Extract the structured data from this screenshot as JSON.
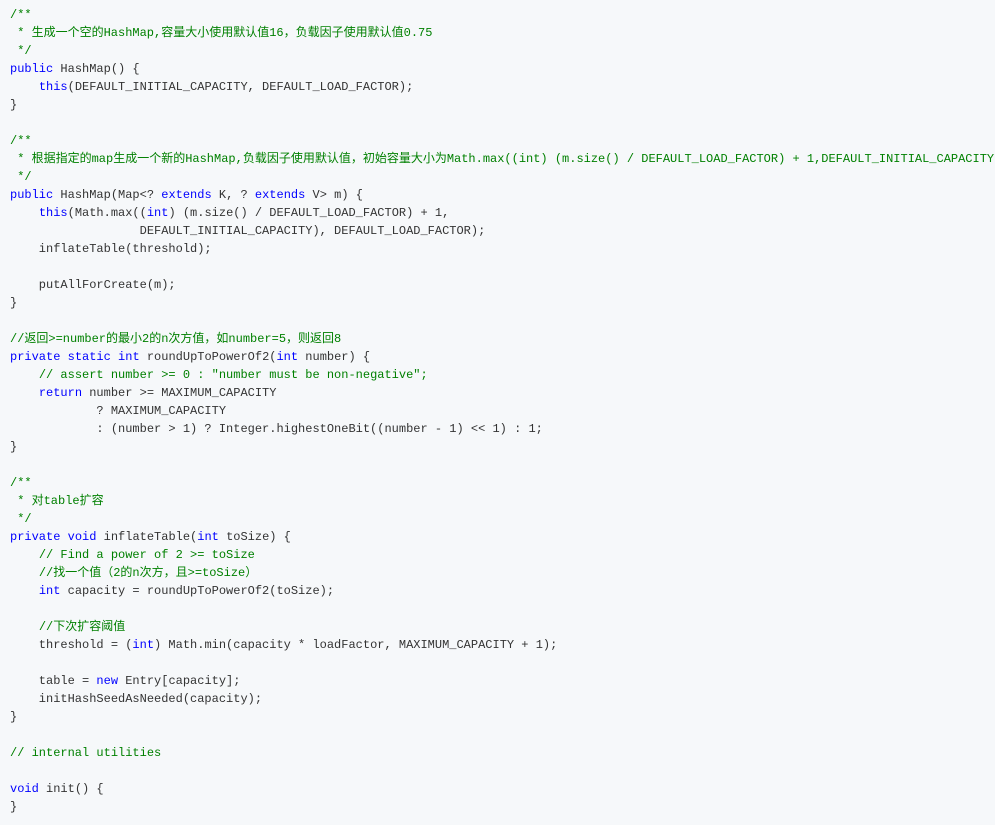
{
  "code": {
    "lines": [
      [
        [
          "comment",
          "/**"
        ]
      ],
      [
        [
          "comment",
          " * 生成一个空的HashMap,容量大小使用默认值16，负载因子使用默认值0.75"
        ]
      ],
      [
        [
          "comment",
          " */"
        ]
      ],
      [
        [
          "keyword",
          "public"
        ],
        [
          "plain",
          " HashMap() {"
        ]
      ],
      [
        [
          "plain",
          "    "
        ],
        [
          "keyword",
          "this"
        ],
        [
          "plain",
          "(DEFAULT_INITIAL_CAPACITY, DEFAULT_LOAD_FACTOR);"
        ]
      ],
      [
        [
          "plain",
          "}"
        ]
      ],
      [
        [
          "plain",
          ""
        ]
      ],
      [
        [
          "comment",
          "/**"
        ]
      ],
      [
        [
          "comment",
          " * 根据指定的map生成一个新的HashMap,负载因子使用默认值，初始容量大小为Math.max((int) (m.size() / DEFAULT_LOAD_FACTOR) + 1,DEFAULT_INITIAL_CAPACITY)"
        ]
      ],
      [
        [
          "comment",
          " */"
        ]
      ],
      [
        [
          "keyword",
          "public"
        ],
        [
          "plain",
          " HashMap(Map<? "
        ],
        [
          "keyword",
          "extends"
        ],
        [
          "plain",
          " K, ? "
        ],
        [
          "keyword",
          "extends"
        ],
        [
          "plain",
          " V> m) {"
        ]
      ],
      [
        [
          "plain",
          "    "
        ],
        [
          "keyword",
          "this"
        ],
        [
          "plain",
          "(Math.max(("
        ],
        [
          "keyword",
          "int"
        ],
        [
          "plain",
          ") (m.size() / DEFAULT_LOAD_FACTOR) + 1,"
        ]
      ],
      [
        [
          "plain",
          "                  DEFAULT_INITIAL_CAPACITY), DEFAULT_LOAD_FACTOR);"
        ]
      ],
      [
        [
          "plain",
          "    inflateTable(threshold);"
        ]
      ],
      [
        [
          "plain",
          ""
        ]
      ],
      [
        [
          "plain",
          "    putAllForCreate(m);"
        ]
      ],
      [
        [
          "plain",
          "}"
        ]
      ],
      [
        [
          "plain",
          ""
        ]
      ],
      [
        [
          "comment",
          "//返回>=number的最小2的n次方值，如number=5，则返回8"
        ]
      ],
      [
        [
          "keyword",
          "private"
        ],
        [
          "plain",
          " "
        ],
        [
          "keyword",
          "static"
        ],
        [
          "plain",
          " "
        ],
        [
          "keyword",
          "int"
        ],
        [
          "plain",
          " roundUpToPowerOf2("
        ],
        [
          "keyword",
          "int"
        ],
        [
          "plain",
          " number) {"
        ]
      ],
      [
        [
          "plain",
          "    "
        ],
        [
          "comment",
          "// assert number >= 0 : \"number must be non-negative\";"
        ]
      ],
      [
        [
          "plain",
          "    "
        ],
        [
          "keyword",
          "return"
        ],
        [
          "plain",
          " number >= MAXIMUM_CAPACITY"
        ]
      ],
      [
        [
          "plain",
          "            ? MAXIMUM_CAPACITY"
        ]
      ],
      [
        [
          "plain",
          "            : (number > 1) ? Integer.highestOneBit((number - 1) << 1) : 1;"
        ]
      ],
      [
        [
          "plain",
          "}"
        ]
      ],
      [
        [
          "plain",
          ""
        ]
      ],
      [
        [
          "comment",
          "/**"
        ]
      ],
      [
        [
          "comment",
          " * 对table扩容"
        ]
      ],
      [
        [
          "comment",
          " */"
        ]
      ],
      [
        [
          "keyword",
          "private"
        ],
        [
          "plain",
          " "
        ],
        [
          "keyword",
          "void"
        ],
        [
          "plain",
          " inflateTable("
        ],
        [
          "keyword",
          "int"
        ],
        [
          "plain",
          " toSize) {"
        ]
      ],
      [
        [
          "plain",
          "    "
        ],
        [
          "comment",
          "// Find a power of 2 >= toSize"
        ]
      ],
      [
        [
          "plain",
          "    "
        ],
        [
          "comment",
          "//找一个值（2的n次方，且>=toSize）"
        ]
      ],
      [
        [
          "plain",
          "    "
        ],
        [
          "keyword",
          "int"
        ],
        [
          "plain",
          " capacity = roundUpToPowerOf2(toSize);"
        ]
      ],
      [
        [
          "plain",
          ""
        ]
      ],
      [
        [
          "plain",
          "    "
        ],
        [
          "comment",
          "//下次扩容阈值"
        ]
      ],
      [
        [
          "plain",
          "    threshold = ("
        ],
        [
          "keyword",
          "int"
        ],
        [
          "plain",
          ") Math.min(capacity * loadFactor, MAXIMUM_CAPACITY + 1);"
        ]
      ],
      [
        [
          "plain",
          ""
        ]
      ],
      [
        [
          "plain",
          "    table = "
        ],
        [
          "keyword",
          "new"
        ],
        [
          "plain",
          " Entry[capacity];"
        ]
      ],
      [
        [
          "plain",
          "    initHashSeedAsNeeded(capacity);"
        ]
      ],
      [
        [
          "plain",
          "}"
        ]
      ],
      [
        [
          "plain",
          ""
        ]
      ],
      [
        [
          "comment",
          "// internal utilities"
        ]
      ],
      [
        [
          "plain",
          ""
        ]
      ],
      [
        [
          "keyword",
          "void"
        ],
        [
          "plain",
          " init() {"
        ]
      ],
      [
        [
          "plain",
          "}"
        ]
      ]
    ]
  }
}
